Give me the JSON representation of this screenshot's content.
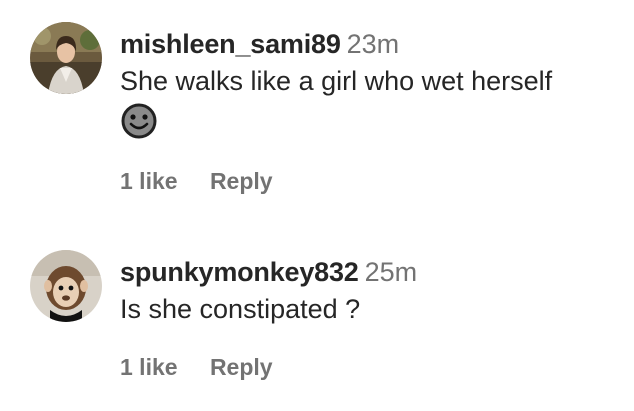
{
  "comments": [
    {
      "username": "mishleen_sami89",
      "time": "23m",
      "text": "She walks like a girl who wet herself",
      "emoji": "smiling-face-emoji",
      "likes": "1 like",
      "reply_label": "Reply",
      "avatar_icon": "profile-photo-woman"
    },
    {
      "username": "spunkymonkey832",
      "time": "25m",
      "text": "Is she constipated ?",
      "likes": "1 like",
      "reply_label": "Reply",
      "avatar_icon": "profile-photo-monkey"
    }
  ],
  "colors": {
    "text_primary": "#262626",
    "text_secondary": "#737373",
    "background": "#ffffff"
  }
}
